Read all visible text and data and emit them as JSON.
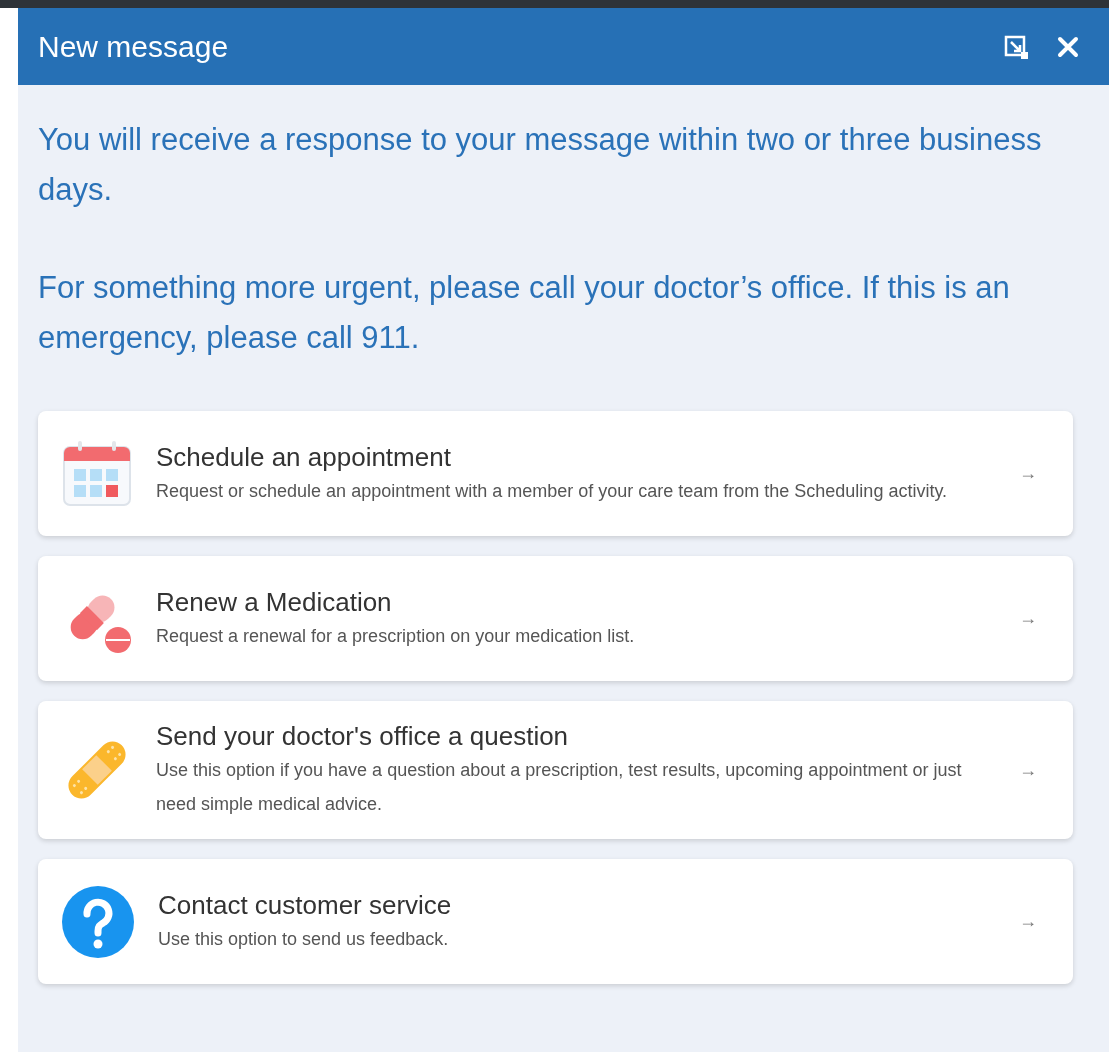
{
  "window": {
    "title": "New message"
  },
  "notices": [
    "You will receive a response to your message within two or three business days.",
    "For something more urgent, please call your doctor’s office. If this is an emergency, please call 911."
  ],
  "options": [
    {
      "kind": "calendar",
      "title": "Schedule an appointment",
      "description": "Request or schedule an appointment with a member of your care team from the Scheduling activity.",
      "arrow": "→"
    },
    {
      "kind": "pill",
      "title": "Renew a Medication",
      "description": "Request a renewal for a prescription on your medication list.",
      "arrow": "→"
    },
    {
      "kind": "bandage",
      "title": "Send your doctor's office a question",
      "description": "Use this option if you have a question about a prescription, test results, upcoming appointment or just need simple medical advice.",
      "arrow": "→"
    },
    {
      "kind": "question",
      "title": "Contact customer service",
      "description": "Use this option to send us feedback.",
      "arrow": "→"
    }
  ]
}
